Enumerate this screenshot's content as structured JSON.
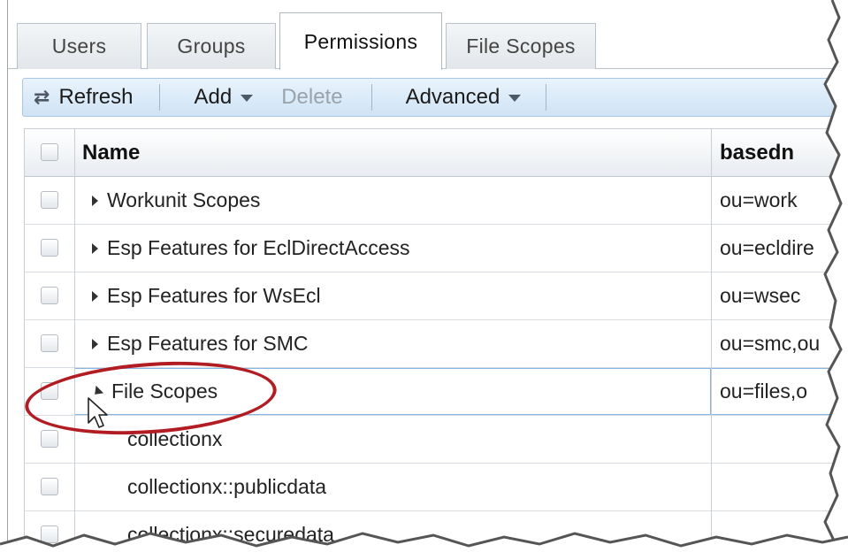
{
  "tabs": [
    {
      "label": "Users"
    },
    {
      "label": "Groups"
    },
    {
      "label": "Permissions",
      "active": true
    },
    {
      "label": "File Scopes"
    }
  ],
  "toolbar": {
    "refresh_label": "Refresh",
    "add_label": "Add",
    "delete_label": "Delete",
    "advanced_label": "Advanced"
  },
  "grid": {
    "columns": {
      "name": "Name",
      "basedn": "basedn"
    },
    "rows": [
      {
        "name": "Workunit Scopes",
        "basedn": "ou=work",
        "expander": "collapsed"
      },
      {
        "name": "Esp Features for EclDirectAccess",
        "basedn": "ou=ecldire",
        "expander": "collapsed"
      },
      {
        "name": "Esp Features for WsEcl",
        "basedn": "ou=wsec",
        "expander": "collapsed"
      },
      {
        "name": "Esp Features for SMC",
        "basedn": "ou=smc,ou",
        "expander": "collapsed"
      },
      {
        "name": "File Scopes",
        "basedn": "ou=files,o",
        "expander": "expanded"
      },
      {
        "name": "collectionx",
        "basedn": "",
        "expander": "none"
      },
      {
        "name": "collectionx::publicdata",
        "basedn": "",
        "expander": "none"
      },
      {
        "name": "collectionx::securedata",
        "basedn": "",
        "expander": "none"
      }
    ]
  },
  "colors": {
    "annotation": "#b11d23",
    "toolbar_bg": "#d9eaf8",
    "focus_border": "#86b6e6"
  }
}
